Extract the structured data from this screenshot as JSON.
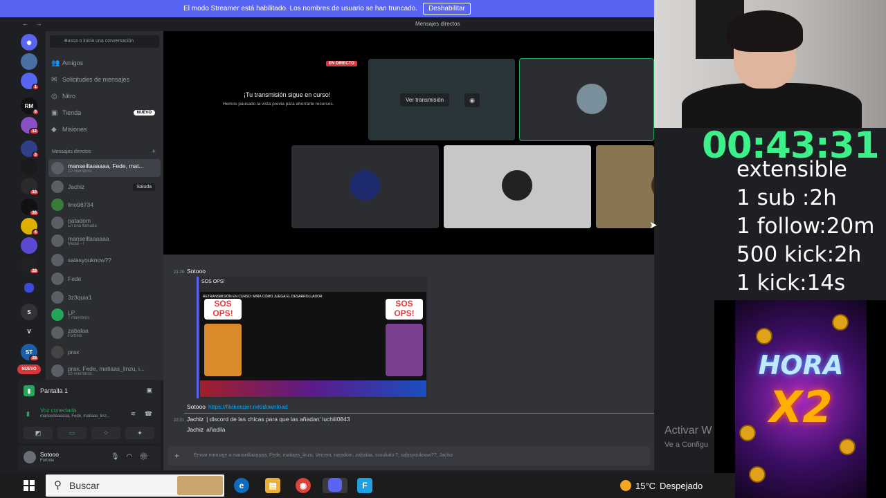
{
  "banner": {
    "text": "El modo Streamer está habilitado. Los nombres de usuario se han truncado.",
    "button": "Deshabilitar"
  },
  "titlebar": {
    "title": "Mensajes directos"
  },
  "servers": [
    {
      "label": "",
      "badge": ""
    },
    {
      "label": "",
      "badge": ""
    },
    {
      "label": "",
      "badge": "1"
    },
    {
      "label": "RM",
      "badge": "9"
    },
    {
      "label": "",
      "badge": "12"
    },
    {
      "label": "",
      "badge": "3"
    },
    {
      "label": "",
      "badge": ""
    },
    {
      "label": "",
      "badge": "10"
    },
    {
      "label": "",
      "badge": "36"
    },
    {
      "label": "",
      "badge": "4"
    },
    {
      "label": "",
      "badge": ""
    },
    {
      "label": "",
      "badge": "28"
    },
    {
      "label": "",
      "badge": ""
    },
    {
      "label": "S",
      "badge": ""
    },
    {
      "label": "V",
      "badge": ""
    },
    {
      "label": "ST",
      "badge": "28"
    },
    {
      "label": "NUEVO",
      "badge": ""
    }
  ],
  "sidebar": {
    "search_placeholder": "Busca o inicia una conversación",
    "nav": [
      {
        "label": "Amigos",
        "icon": "friends-icon"
      },
      {
        "label": "Solicitudes de mensajes",
        "icon": "mail-icon"
      },
      {
        "label": "Nitro",
        "icon": "nitro-icon"
      },
      {
        "label": "Tienda",
        "icon": "shop-icon",
        "badge": "NUEVO"
      },
      {
        "label": "Misiones",
        "icon": "quest-icon"
      }
    ],
    "dm_header": "Mensajes directos",
    "dms": [
      {
        "name": "manseillaaaaaa, Fede, mat...",
        "sub": "10 miembros"
      },
      {
        "name": "Jachiz",
        "sub": "",
        "action": "Saluda"
      },
      {
        "name": "lino98734",
        "sub": ""
      },
      {
        "name": "natadom",
        "sub": "En una llamada"
      },
      {
        "name": "manseillaaaaaa",
        "sub": "Medal ~!"
      },
      {
        "name": "salasyouknow??",
        "sub": ""
      },
      {
        "name": "Fede",
        "sub": ""
      },
      {
        "name": "3z3quia1",
        "sub": ""
      },
      {
        "name": "LP",
        "sub": "7 miembros"
      },
      {
        "name": "zabalaa",
        "sub": "Fortnite"
      },
      {
        "name": "prax",
        "sub": ""
      },
      {
        "name": "prax, Fede, matiaas_linzu, i...",
        "sub": "10 miembros"
      }
    ]
  },
  "voice": {
    "screen": "Pantalla 1",
    "status": "Voz conectada",
    "channel": "manseillaaaaaa, Fede, matiaas_linz..."
  },
  "user": {
    "name": "Sotooo",
    "status": "Fortnite"
  },
  "stream": {
    "live_badge": "EN DIRECTO",
    "title": "¡Tu transmisión sigue en curso!",
    "subtitle": "Hemos pausado la vista previa para ahorrarte recursos.",
    "watch": "Ver transmisión"
  },
  "chat": {
    "msg1": {
      "time": "21:29",
      "author": "Sotooo"
    },
    "embed": {
      "title": "SOS OPS!",
      "announcement": "RETRANSMISIÓN EN CURSO: MIRA CÓMO JUEGA EL DESARROLLADOR",
      "game_logo": "SOS OPS!"
    },
    "msg2": {
      "author": "Sotooo",
      "link": "https://filekeeper.net/download"
    },
    "msg3": {
      "time": "22:21",
      "author": "Jachiz",
      "text": "| discord de las chicas para que las añadan' luchiii0843"
    },
    "msg4": {
      "author": "Jachiz",
      "text": "añadila"
    },
    "composer_placeholder": "Enviar mensaje a manseillaaaaaa, Fede, matiaas_linzu, Veicent, natadom, zabalaa, ssxuluito ?, salasyouknow??, Jachiz"
  },
  "watermark": {
    "line1": "Activar W",
    "line2": "Ve a Configu"
  },
  "overlay": {
    "timer": "00:43:31",
    "lines": [
      "extensible",
      "1 sub :2h",
      "1 follow:20m",
      "500 kick:2h",
      "1 kick:14s"
    ],
    "promo_top": "HORA",
    "promo_bottom": "X2"
  },
  "taskbar": {
    "search": "Buscar",
    "weather_temp": "15°C",
    "weather_text": "Despejado"
  },
  "colors": {
    "brand": "#5865f2",
    "timer": "#3cf08a",
    "online": "#23a55a",
    "live": "#da373c"
  }
}
